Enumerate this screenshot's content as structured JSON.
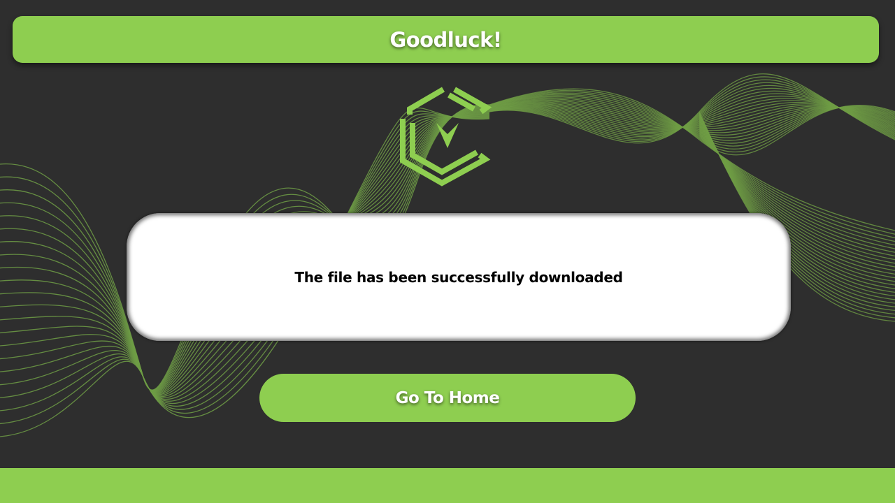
{
  "header": {
    "title": "Goodluck!"
  },
  "logo": {
    "icon": "hexagon-chevron-logo-icon"
  },
  "message": {
    "text": "The file has been successfully downloaded"
  },
  "actions": {
    "home_label": "Go To Home"
  },
  "colors": {
    "background": "#2e2e2e",
    "accent": "#8ece50",
    "wave_lines": "#6f9e45",
    "card": "#ffffff",
    "card_text": "#000000",
    "label_text": "#ffffff"
  }
}
